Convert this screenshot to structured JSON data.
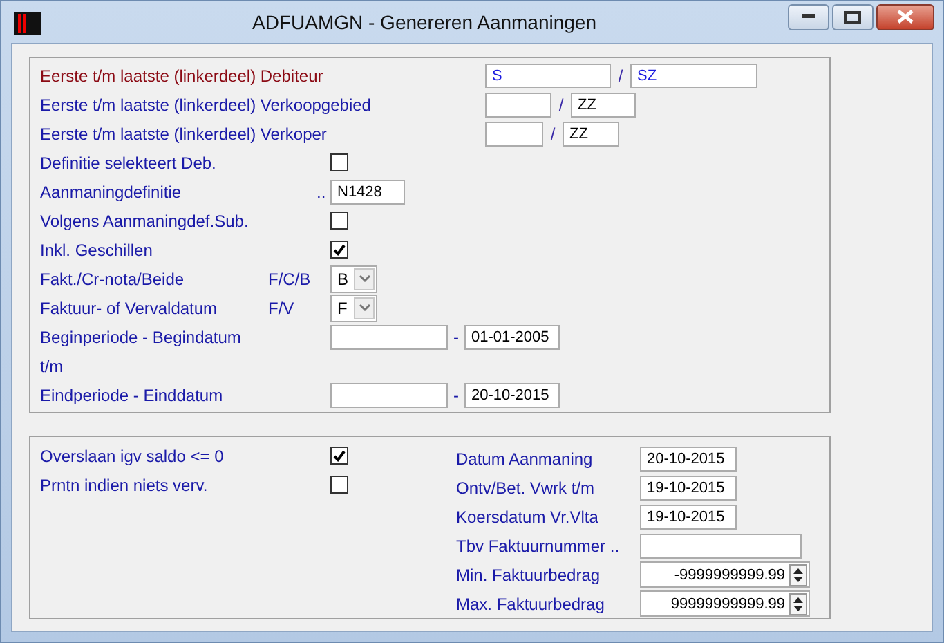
{
  "window": {
    "title": "ADFUAMGN - Genereren Aanmaningen"
  },
  "selection": [
    {
      "kind": "range",
      "label": "Eerste t/m laatste (linkerdeel) Debiteur",
      "active": true,
      "from": "S",
      "separator": "/",
      "to": "SZ"
    },
    {
      "kind": "range",
      "label": "Eerste t/m laatste (linkerdeel) Verkoopgebied",
      "active": false,
      "separator": "/",
      "to": "ZZ"
    },
    {
      "kind": "range",
      "label": "Eerste t/m laatste (linkerdeel) Verkoper",
      "active": false,
      "separator": "/",
      "to": "ZZ"
    },
    {
      "kind": "checkbox",
      "label": "Definitie selekteert Deb.",
      "checked": false
    },
    {
      "kind": "text",
      "label": "Aanmaningdefinitie",
      "prefix": "..",
      "value": "N1428"
    },
    {
      "kind": "checkbox",
      "label": "Volgens Aanmaningdef.Sub.",
      "checked": false
    },
    {
      "kind": "checkbox",
      "label": "Inkl. Geschillen",
      "checked": true
    },
    {
      "kind": "select",
      "label": "Fakt./Cr-nota/Beide",
      "code": "F/C/B",
      "value": "B"
    },
    {
      "kind": "select",
      "label": "Faktuur- of Vervaldatum",
      "code": "F/V",
      "value": "F"
    },
    {
      "kind": "date",
      "label": "Beginperiode - Begindatum",
      "separator": "-",
      "to": "01-01-2005"
    },
    {
      "kind": "label",
      "label": "t/m"
    },
    {
      "kind": "date",
      "label": "Eindperiode  - Einddatum",
      "separator": "-",
      "to": "20-10-2015"
    }
  ],
  "options": [
    {
      "label": "Overslaan igv saldo <= 0",
      "checked": true
    },
    {
      "label": "Prntn indien niets verv.",
      "checked": false
    }
  ],
  "parameters": [
    {
      "kind": "date",
      "label": "Datum Aanmaning",
      "value": "20-10-2015"
    },
    {
      "kind": "date",
      "label": "Ontv/Bet. Vwrk t/m",
      "value": "19-10-2015"
    },
    {
      "kind": "date",
      "label": "Koersdatum Vr.Vlta",
      "value": "19-10-2015"
    },
    {
      "kind": "text",
      "label": "Tbv  Faktuurnummer .."
    },
    {
      "kind": "spin",
      "label": "Min. Faktuurbedrag",
      "value": "-9999999999.99"
    },
    {
      "kind": "spin",
      "label": "Max. Faktuurbedrag",
      "value": "99999999999.99"
    }
  ]
}
